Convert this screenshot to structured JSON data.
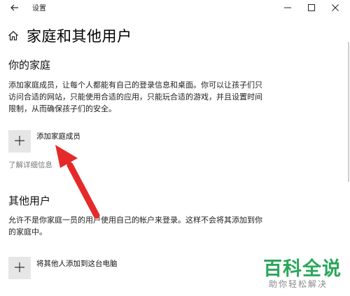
{
  "window": {
    "title": "设置"
  },
  "header": {
    "page_title": "家庭和其他用户"
  },
  "family": {
    "section_title": "你的家庭",
    "description": "添加家庭成员，让每个人都能有自己的登录信息和桌面。你可以让孩子们只访问合适的网站，只能使用合适的应用，只能玩合适的游戏，并且设置时间限制，从而确保孩子们的安全。",
    "add_label": "添加家庭成员",
    "learn_more": "了解详细信息"
  },
  "other_users": {
    "section_title": "其他用户",
    "description": "允许不是你家庭一员的用户使用自己的帐户来登录。这样不会将其添加到你的家庭中。",
    "add_label": "将其他人添加到这台电脑"
  },
  "watermark": {
    "brand": "百科全说",
    "slogan": "助你轻松解决"
  },
  "colors": {
    "arrow": "#e52a2a",
    "brand_green": "#2aa75a",
    "tile_bg": "#e6e6e6"
  }
}
